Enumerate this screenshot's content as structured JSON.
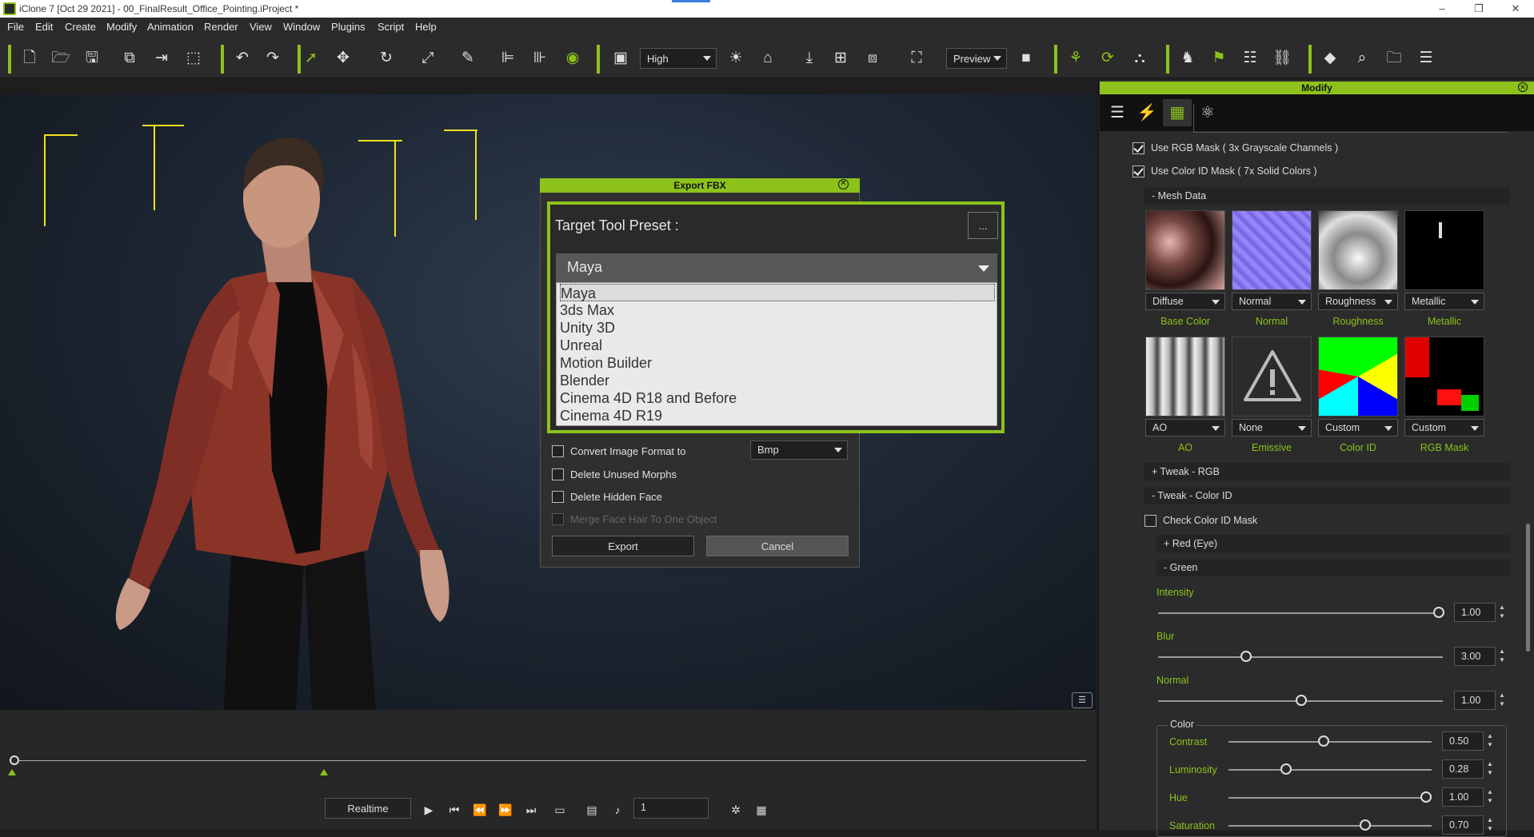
{
  "window": {
    "title": "iClone 7 [Oct 29 2021] - 00_FinalResult_Office_Pointing.iProject *",
    "min": "–",
    "restore": "❐",
    "close": "✕"
  },
  "menu": [
    "File",
    "Edit",
    "Create",
    "Modify",
    "Animation",
    "Render",
    "View",
    "Window",
    "Plugins",
    "Script",
    "Help"
  ],
  "toolbar": {
    "quality_value": "High",
    "render_mode_value": "Preview"
  },
  "export_dialog": {
    "title": "Export FBX",
    "target_label": "Target Tool Preset :",
    "more_button": "...",
    "selected_preset": "Maya",
    "preset_options": [
      "Maya",
      "3ds Max",
      "Unity 3D",
      "Unreal",
      "Motion Builder",
      "Blender",
      "Cinema 4D R18 and Before",
      "Cinema 4D R19"
    ],
    "convert_label": "Convert Image Format to",
    "convert_value": "Bmp",
    "delete_morphs_label": "Delete Unused Morphs",
    "delete_hidden_label": "Delete Hidden Face",
    "merge_label": "Merge Face Hair To One Object",
    "export_button": "Export",
    "cancel_button": "Cancel"
  },
  "timeline": {
    "realtime_label": "Realtime",
    "frame_value": "1"
  },
  "panel": {
    "title": "Modify",
    "use_rgb_mask": "Use RGB Mask ( 3x Grayscale Channels )",
    "use_color_id_mask": "Use Color ID Mask ( 7x Solid Colors )",
    "mesh_data": "-  Mesh Data",
    "textures_row1": [
      {
        "combo": "Diffuse",
        "label": "Base Color"
      },
      {
        "combo": "Normal",
        "label": "Normal"
      },
      {
        "combo": "Roughness",
        "label": "Roughness"
      },
      {
        "combo": "Metallic",
        "label": "Metallic"
      }
    ],
    "textures_row2": [
      {
        "combo": "AO",
        "label": "AO"
      },
      {
        "combo": "None",
        "label": "Emissive"
      },
      {
        "combo": "Custom",
        "label": "Color ID"
      },
      {
        "combo": "Custom",
        "label": "RGB Mask"
      }
    ],
    "tweak_rgb": "+  Tweak - RGB",
    "tweak_color_id": "-  Tweak - Color ID",
    "check_color_id": "Check Color ID Mask",
    "red_eye": "+  Red (Eye)",
    "green": "-  Green",
    "intensity_label": "Intensity",
    "intensity_value": "1.00",
    "blur_label": "Blur",
    "blur_value": "3.00",
    "normal_label": "Normal",
    "normal_value": "1.00",
    "color_group": "Color",
    "contrast_label": "Contrast",
    "contrast_value": "0.50",
    "luminosity_label": "Luminosity",
    "luminosity_value": "0.28",
    "hue_label": "Hue",
    "hue_value": "1.00",
    "saturation_label": "Saturation",
    "saturation_value": "0.70"
  },
  "colors": {
    "accent": "#8cc21b",
    "guide_lines": "#f0e020"
  }
}
